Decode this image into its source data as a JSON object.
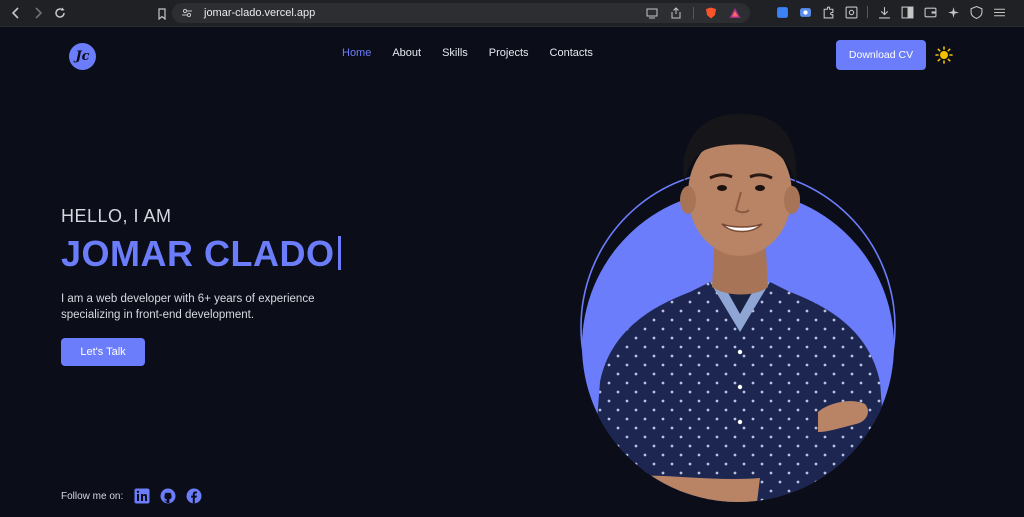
{
  "browser": {
    "url": "jomar-clado.vercel.app"
  },
  "site": {
    "logo_text": "Jc",
    "nav": [
      {
        "label": "Home",
        "active": true
      },
      {
        "label": "About",
        "active": false
      },
      {
        "label": "Skills",
        "active": false
      },
      {
        "label": "Projects",
        "active": false
      },
      {
        "label": "Contacts",
        "active": false
      }
    ],
    "download_cv": "Download CV",
    "theme_icon": "sun-icon",
    "accent_color": "#6b7dfa",
    "background_color": "#0b0d19"
  },
  "hero": {
    "greeting": "HELLO, I AM",
    "name": "JOMAR CLADO",
    "intro": "I am a web developer with 6+ years of experience specializing in front-end development.",
    "cta": "Let's Talk",
    "follow_label": "Follow me on:",
    "socials": [
      "linkedin-icon",
      "github-icon",
      "facebook-icon"
    ]
  }
}
